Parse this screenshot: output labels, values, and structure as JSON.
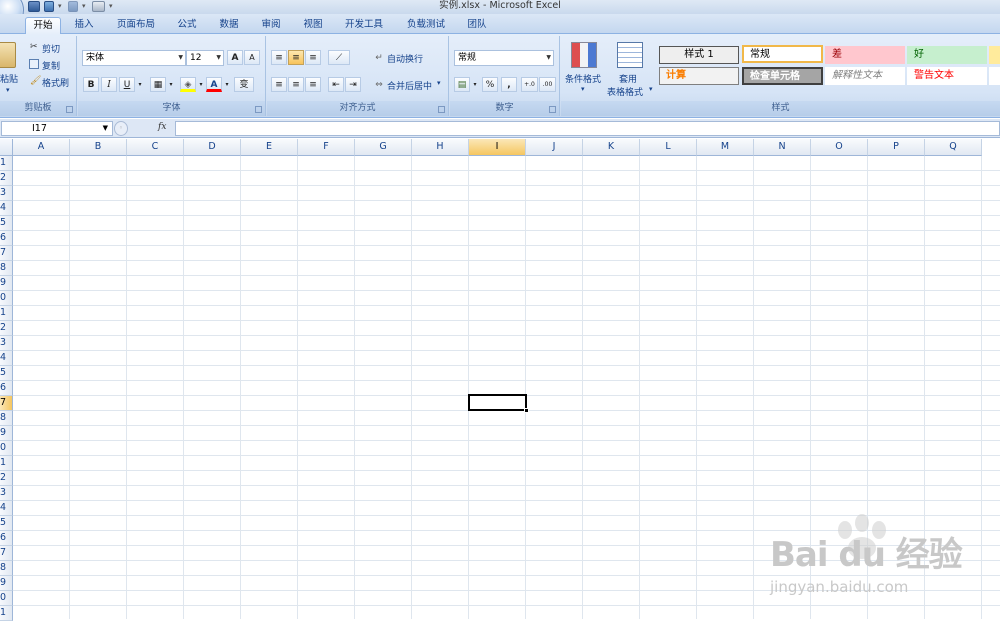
{
  "window": {
    "title": "实例.xlsx - Microsoft Excel"
  },
  "tabs": [
    "开始",
    "插入",
    "页面布局",
    "公式",
    "数据",
    "审阅",
    "视图",
    "开发工具",
    "负载测试",
    "团队"
  ],
  "ribbon": {
    "clipboard": {
      "label": "剪贴板",
      "paste": "粘贴",
      "cut": "剪切",
      "copy": "复制",
      "format_painter": "格式刷"
    },
    "font": {
      "label": "字体",
      "font_name": "宋体",
      "font_size": "12",
      "bold": "B",
      "italic": "I",
      "underline": "U",
      "grow": "A",
      "shrink": "A",
      "font_color": "A",
      "phonetic": "变"
    },
    "alignment": {
      "label": "对齐方式",
      "wrap_text": "自动换行",
      "merge_center": "合并后居中"
    },
    "number": {
      "label": "数字",
      "format": "常规",
      "percent": "%",
      "comma": ",",
      "inc_decimal": "+.0",
      "dec_decimal": ".00"
    },
    "styles": {
      "label": "样式",
      "conditional": "条件格式",
      "table_format_1": "套用",
      "table_format_2": "表格格式",
      "cells": [
        {
          "text": "样式 1",
          "bg": "#eeeeee",
          "color": "#000000"
        },
        {
          "text": "常规",
          "bg": "#ffffff",
          "color": "#000000"
        },
        {
          "text": "差",
          "bg": "#ffc7ce",
          "color": "#9c0006"
        },
        {
          "text": "好",
          "bg": "#c6efce",
          "color": "#006100"
        },
        {
          "text": "计算",
          "bg": "#f2f2f2",
          "color": "#fa7d00"
        },
        {
          "text": "检查单元格",
          "bg": "#a5a5a5",
          "color": "#ffffff"
        },
        {
          "text": "解释性文本",
          "bg": "#ffffff",
          "color": "#7f7f7f"
        },
        {
          "text": "警告文本",
          "bg": "#ffffff",
          "color": "#ff0000"
        }
      ]
    }
  },
  "formula_bar": {
    "name_box": "I17",
    "fx": "fx",
    "formula": ""
  },
  "columns": [
    "A",
    "B",
    "C",
    "D",
    "E",
    "F",
    "G",
    "H",
    "I",
    "J",
    "K",
    "L",
    "M",
    "N",
    "O",
    "P",
    "Q"
  ],
  "rows": [
    "1",
    "2",
    "3",
    "4",
    "5",
    "6",
    "7",
    "8",
    "9",
    "0",
    "1",
    "2",
    "3",
    "4",
    "5",
    "6",
    "7",
    "8",
    "9",
    "0",
    "1",
    "2",
    "3",
    "4",
    "5",
    "6",
    "7",
    "8",
    "9",
    "0",
    "1"
  ],
  "selection": {
    "column": "I",
    "row": "7"
  },
  "watermark": {
    "text": "Bai du 经验",
    "url": "jingyan.baidu.com"
  }
}
